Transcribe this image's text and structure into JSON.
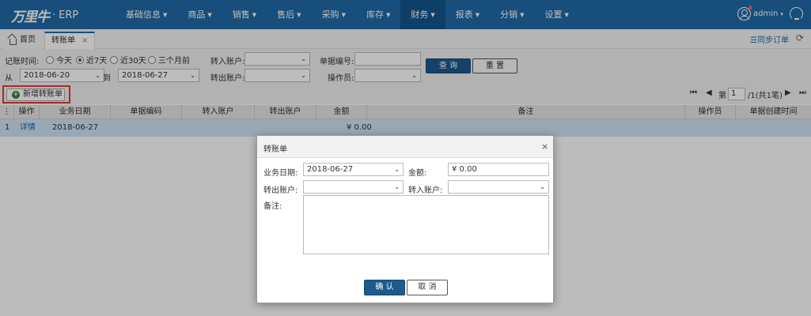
{
  "app": {
    "logo_text": "万里牛",
    "logo_dot": "·",
    "logo_erp": "ERP"
  },
  "nav": [
    {
      "label": "基础信息"
    },
    {
      "label": "商品"
    },
    {
      "label": "销售"
    },
    {
      "label": "售后"
    },
    {
      "label": "采购"
    },
    {
      "label": "库存"
    },
    {
      "label": "财务"
    },
    {
      "label": "报表"
    },
    {
      "label": "分销"
    },
    {
      "label": "设置"
    }
  ],
  "nav_active": "财务",
  "user": {
    "name": "admin",
    "caret": "▾"
  },
  "tabs": {
    "home": "首页",
    "active": "转账单",
    "close": "×"
  },
  "sync": "☰同步订单",
  "refresh": "⟳",
  "filter": {
    "time_label": "记账时间:",
    "radios": [
      {
        "label": "今天",
        "checked": false
      },
      {
        "label": "近7天",
        "checked": true
      },
      {
        "label": "近30天",
        "checked": false
      },
      {
        "label": "三个月前",
        "checked": false
      }
    ],
    "from_label": "从",
    "from_value": "2018-06-20",
    "to_label": "到",
    "to_value": "2018-06-27",
    "in_account_label": "转入账户:",
    "out_account_label": "转出账户:",
    "doc_no_label": "单据编号:",
    "operator_label": "操作员:",
    "query_btn": "查 询",
    "reset_btn": "重 置"
  },
  "add_btn": "新增转账单",
  "pager": {
    "first": "⏮",
    "prev": "◀",
    "page_label": "第",
    "page_value": "1",
    "total": "/1(共1笔)",
    "next": "▶",
    "last": "⏭"
  },
  "table": {
    "headers": [
      "⋮",
      "操作",
      "业务日期",
      "单据编码",
      "转入账户",
      "转出账户",
      "金额",
      "备注",
      "操作员",
      "单据创建时间"
    ],
    "rows": [
      {
        "index": "1",
        "action": "详情",
        "date": "2018-06-27",
        "code": "",
        "in": "",
        "out": "",
        "amount": "¥ 0.00",
        "note": "",
        "operator": "",
        "created": ""
      }
    ]
  },
  "dialog": {
    "title": "转账单",
    "close": "×",
    "date_label": "业务日期:",
    "date_value": "2018-06-27",
    "amount_label": "金额:",
    "amount_value": "¥ 0.00",
    "out_label": "转出账户:",
    "in_label": "转入账户:",
    "note_label": "备注:",
    "confirm": "确 认",
    "cancel": "取 消"
  },
  "colors": {
    "brand": "#1f6aa8",
    "highlight": "#e53935",
    "row_selected": "#cfe3f5"
  }
}
